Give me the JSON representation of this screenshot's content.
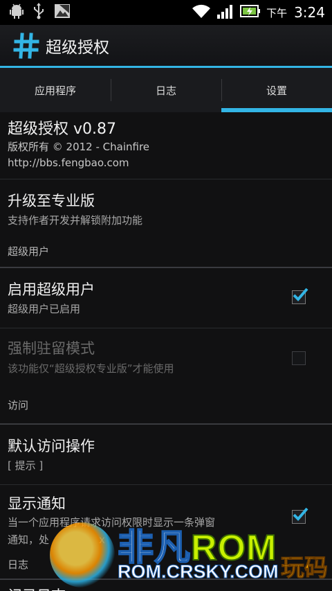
{
  "status_bar": {
    "ampm": "下午",
    "time": "3:24",
    "icons": [
      "android-debug-icon",
      "usb-icon",
      "image-icon",
      "wifi-icon",
      "signal-icon",
      "battery-charging-icon"
    ],
    "accent": "#33b5e5"
  },
  "action_bar": {
    "icon": "hash-icon",
    "title": "超级授权"
  },
  "tabs": [
    {
      "label": "应用程序",
      "active": false
    },
    {
      "label": "日志",
      "active": false
    },
    {
      "label": "设置",
      "active": true
    }
  ],
  "items": {
    "about": {
      "title": "超级授权 v0.87",
      "line1": "版权所有 © 2012 - Chainfire",
      "line2": "http://bbs.fengbao.com"
    },
    "upgrade": {
      "title": "升级至专业版",
      "subtitle": "支持作者开发并解锁附加功能"
    },
    "section_superuser": "超级用户",
    "enable_superuser": {
      "title": "启用超级用户",
      "subtitle": "超级用户已启用",
      "checked": true
    },
    "force_resident": {
      "title": "强制驻留模式",
      "subtitle": "该功能仅“超级授权专业版”才能使用",
      "checked": false,
      "enabled": false
    },
    "section_access": "访问",
    "default_access": {
      "title": "默认访问操作",
      "subtitle": "[ 提示 ]"
    },
    "show_notification": {
      "title": "显示通知",
      "subtitle_line1": "当一个应用程序请求访问权限时显示一条弹窗",
      "subtitle_line2": "通知，处",
      "subtitle_trail": "x",
      "checked": true
    },
    "section_log": "日志",
    "partial_item": "记录日志"
  },
  "watermark": {
    "brand_prefix": "非凡",
    "brand_rom": "ROM",
    "url": "ROM.CRSKY.COM",
    "right_text": "玩码"
  }
}
